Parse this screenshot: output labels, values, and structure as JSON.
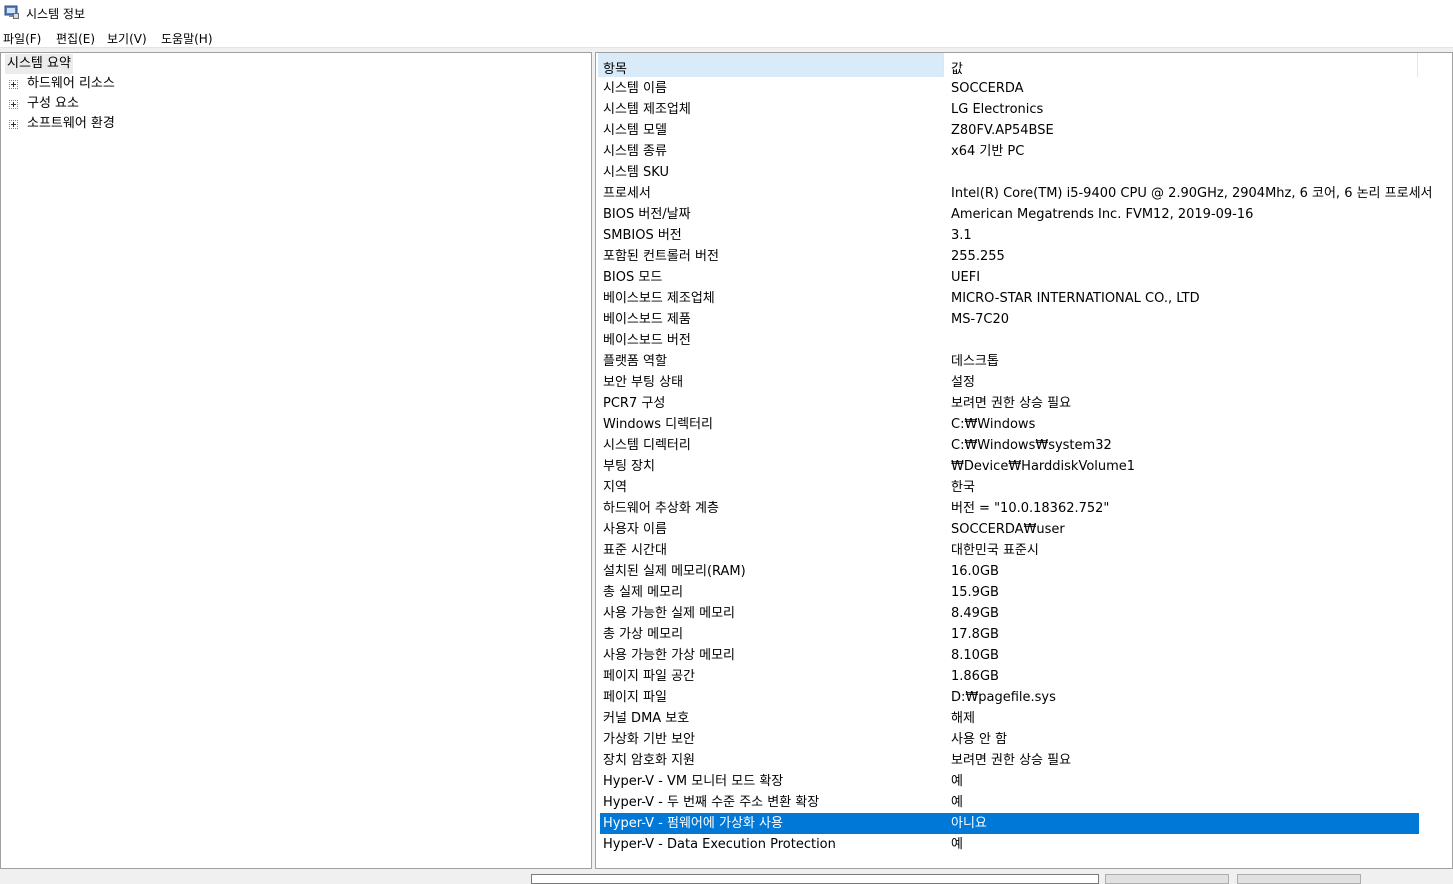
{
  "window": {
    "title": "시스템 정보"
  },
  "menu": [
    "파일(F)",
    "편집(E)",
    "보기(V)",
    "도움말(H)"
  ],
  "tree": {
    "root": "시스템 요약",
    "children": [
      "하드웨어 리소스",
      "구성 요소",
      "소프트웨어 환경"
    ]
  },
  "table": {
    "headers": {
      "item": "항목",
      "value": "값"
    },
    "rows": [
      {
        "item": "시스템 이름",
        "value": "SOCCERDA"
      },
      {
        "item": "시스템 제조업체",
        "value": "LG Electronics"
      },
      {
        "item": "시스템 모델",
        "value": "Z80FV.AP54BSE"
      },
      {
        "item": "시스템 종류",
        "value": "x64 기반 PC"
      },
      {
        "item": "시스템 SKU",
        "value": ""
      },
      {
        "item": "프로세서",
        "value": "Intel(R) Core(TM) i5-9400 CPU @ 2.90GHz, 2904Mhz, 6 코어, 6 논리 프로세서"
      },
      {
        "item": "BIOS 버전/날짜",
        "value": "American Megatrends Inc. FVM12, 2019-09-16"
      },
      {
        "item": "SMBIOS 버전",
        "value": "3.1"
      },
      {
        "item": "포함된 컨트롤러 버전",
        "value": "255.255"
      },
      {
        "item": "BIOS 모드",
        "value": "UEFI"
      },
      {
        "item": "베이스보드 제조업체",
        "value": "MICRO-STAR INTERNATIONAL CO., LTD"
      },
      {
        "item": "베이스보드 제품",
        "value": "MS-7C20"
      },
      {
        "item": "베이스보드 버전",
        "value": ""
      },
      {
        "item": "플랫폼 역할",
        "value": "데스크톱"
      },
      {
        "item": "보안 부팅 상태",
        "value": "설정"
      },
      {
        "item": "PCR7 구성",
        "value": "보려면 권한 상승 필요"
      },
      {
        "item": "Windows 디렉터리",
        "value": "C:₩Windows"
      },
      {
        "item": "시스템 디렉터리",
        "value": "C:₩Windows₩system32"
      },
      {
        "item": "부팅 장치",
        "value": "₩Device₩HarddiskVolume1"
      },
      {
        "item": "지역",
        "value": "한국"
      },
      {
        "item": "하드웨어 추상화 계층",
        "value": "버전 = \"10.0.18362.752\""
      },
      {
        "item": "사용자 이름",
        "value": "SOCCERDA₩user"
      },
      {
        "item": "표준 시간대",
        "value": "대한민국 표준시"
      },
      {
        "item": "설치된 실제 메모리(RAM)",
        "value": "16.0GB"
      },
      {
        "item": "총 실제 메모리",
        "value": "15.9GB"
      },
      {
        "item": "사용 가능한 실제 메모리",
        "value": "8.49GB"
      },
      {
        "item": "총 가상 메모리",
        "value": "17.8GB"
      },
      {
        "item": "사용 가능한 가상 메모리",
        "value": "8.10GB"
      },
      {
        "item": "페이지 파일 공간",
        "value": "1.86GB"
      },
      {
        "item": "페이지 파일",
        "value": "D:₩pagefile.sys"
      },
      {
        "item": "커널 DMA 보호",
        "value": "해제"
      },
      {
        "item": "가상화 기반 보안",
        "value": "사용 안 함"
      },
      {
        "item": "장치 암호화 지원",
        "value": "보려면 권한 상승 필요"
      },
      {
        "item": "Hyper-V - VM 모니터 모드 확장",
        "value": "예"
      },
      {
        "item": "Hyper-V - 두 번째 수준 주소 변환 확장",
        "value": "예"
      },
      {
        "item": "Hyper-V - 펌웨어에 가상화 사용",
        "value": "아니요",
        "selected": true
      },
      {
        "item": "Hyper-V - Data Execution Protection",
        "value": "예"
      }
    ]
  }
}
